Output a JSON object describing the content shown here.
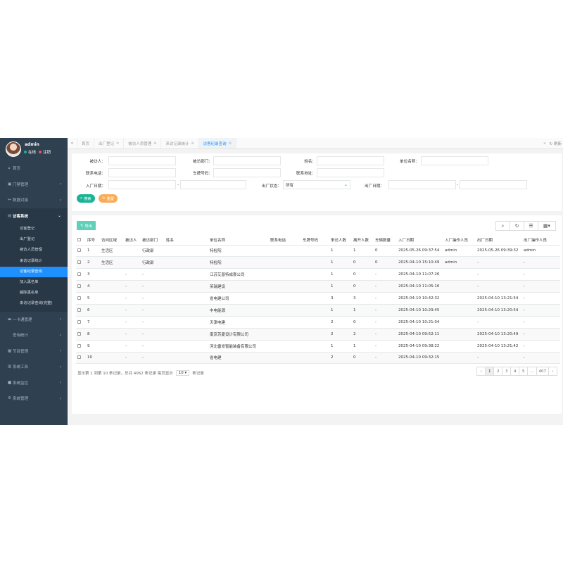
{
  "user": {
    "name": "admin",
    "online": "在线",
    "logout": "注销"
  },
  "nav": {
    "home": "首页",
    "gate": "门禁管理",
    "docking": "数据对接",
    "visitor": "访客系统",
    "visitor_sub": [
      "访客登记",
      "出厂登记",
      "被访人员管理",
      "来访记录统计",
      "访客纪录查询",
      "加入黑名单",
      "解除黑名单",
      "来访记录查询(完整)"
    ],
    "card": "一卡通管理",
    "query": "查询统计",
    "program": "节目管理",
    "tools": "系统工具",
    "monitor": "系统监控",
    "sysmgr": "系统管理"
  },
  "tabs": [
    "首页",
    "出厂登记",
    "被访人员管理",
    "来访记录统计",
    "访客纪录查询"
  ],
  "tabbar_refresh": "刷新",
  "search": {
    "visited_person": "被访人：",
    "visited_dept": "被访部门：",
    "name": "姓名：",
    "company": "单位名称：",
    "phone": "联系电话：",
    "plate": "车牌号码：",
    "address": "联系地址：",
    "in_date": "入厂日期：",
    "out_status": "出厂状态：",
    "out_status_value": "所有",
    "out_date": "出厂日期：",
    "dash": "-",
    "search_btn": "搜索",
    "reset_btn": "重置"
  },
  "table": {
    "export_btn": "导出",
    "columns": [
      "",
      "序号",
      "访问区域",
      "被访人",
      "被访部门",
      "姓名",
      "单位名称",
      "联系电话",
      "车牌号码",
      "来访人数",
      "离开人数",
      "车辆数量",
      "入厂日期",
      "入厂操作人员",
      "出厂日期",
      "出厂操作人员"
    ],
    "rows": [
      [
        "",
        "1",
        "生活区",
        "",
        "行政部",
        "",
        "特检院",
        "",
        "",
        "1",
        "1",
        "0",
        "2025-05-26 09:37:54",
        "admin",
        "2025-05-26 09:39:32",
        "admin"
      ],
      [
        "",
        "2",
        "生活区",
        "",
        "行政部",
        "",
        "特检院",
        "",
        "",
        "1",
        "0",
        "0",
        "2025-04-10 15:10:49",
        "admin",
        "-",
        "-"
      ],
      [
        "",
        "3",
        "",
        "-",
        "-",
        "",
        "江苏艾普特成套公司",
        "",
        "",
        "1",
        "0",
        "-",
        "2025-04-10 11:07:26",
        "",
        "-",
        "-"
      ],
      [
        "",
        "4",
        "",
        "-",
        "-",
        "",
        "英瑞建设",
        "",
        "",
        "1",
        "0",
        "-",
        "2025-04-10 11:05:16",
        "",
        "-",
        "-"
      ],
      [
        "",
        "5",
        "",
        "-",
        "-",
        "",
        "省电建公司",
        "",
        "",
        "3",
        "3",
        "-",
        "2025-04-10 10:42:32",
        "",
        "2025-04-10 13:21:54",
        "-"
      ],
      [
        "",
        "6",
        "",
        "-",
        "-",
        "",
        "中电能源",
        "",
        "",
        "1",
        "1",
        "-",
        "2025-04-10 10:29:45",
        "",
        "2025-04-10 13:20:54",
        "-"
      ],
      [
        "",
        "7",
        "",
        "-",
        "-",
        "",
        "天津电建",
        "",
        "",
        "2",
        "0",
        "-",
        "2025-04-10 10:21:04",
        "",
        "-",
        "-"
      ],
      [
        "",
        "8",
        "",
        "-",
        "-",
        "",
        "南京苏夏设计有限公司",
        "",
        "",
        "2",
        "2",
        "-",
        "2025-04-10 09:52:11",
        "",
        "2025-04-10 13:20:49",
        "-"
      ],
      [
        "",
        "9",
        "",
        "-",
        "-",
        "",
        "河北雷发智能装备有限公司",
        "",
        "",
        "1",
        "1",
        "-",
        "2025-04-10 09:38:22",
        "",
        "2025-04-10 13:21:42",
        "-"
      ],
      [
        "",
        "10",
        "",
        "-",
        "-",
        "",
        "省电建",
        "",
        "",
        "2",
        "0",
        "-",
        "2025-04-10 09:32:15",
        "",
        "-",
        "-"
      ]
    ]
  },
  "pager": {
    "info_prefix": "显示第 1 到第 10 条记录，总共 4062 条记录 每页显示",
    "page_size": "10",
    "info_suffix": "条记录",
    "pages": [
      "‹",
      "1",
      "2",
      "3",
      "4",
      "5",
      "...",
      "407",
      "›"
    ]
  }
}
